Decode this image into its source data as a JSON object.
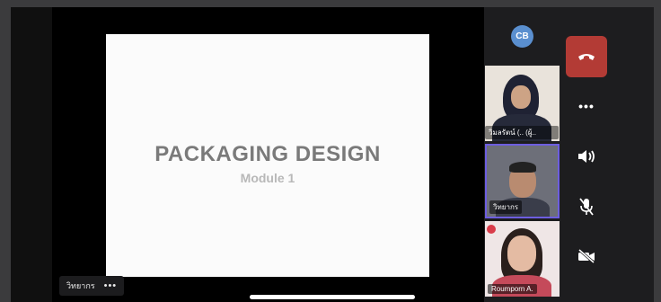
{
  "presentation": {
    "title": "PACKAGING DESIGN",
    "subtitle": "Module 1"
  },
  "speaker": {
    "name": "วิทยากร",
    "more": "•••"
  },
  "participants": [
    {
      "initials": "CB"
    },
    {
      "name": "วิมลรัตน์ (.. (ผู้..",
      "mic_icon": "mic-muted-icon"
    },
    {
      "name": "วิทยากร"
    },
    {
      "name": "Roumporn A."
    }
  ],
  "controls": {
    "more": "•••",
    "end_call_color": "#b33b35",
    "active_speaker_color": "#6d5ee0",
    "avatar_color": "#5a8fcf"
  }
}
